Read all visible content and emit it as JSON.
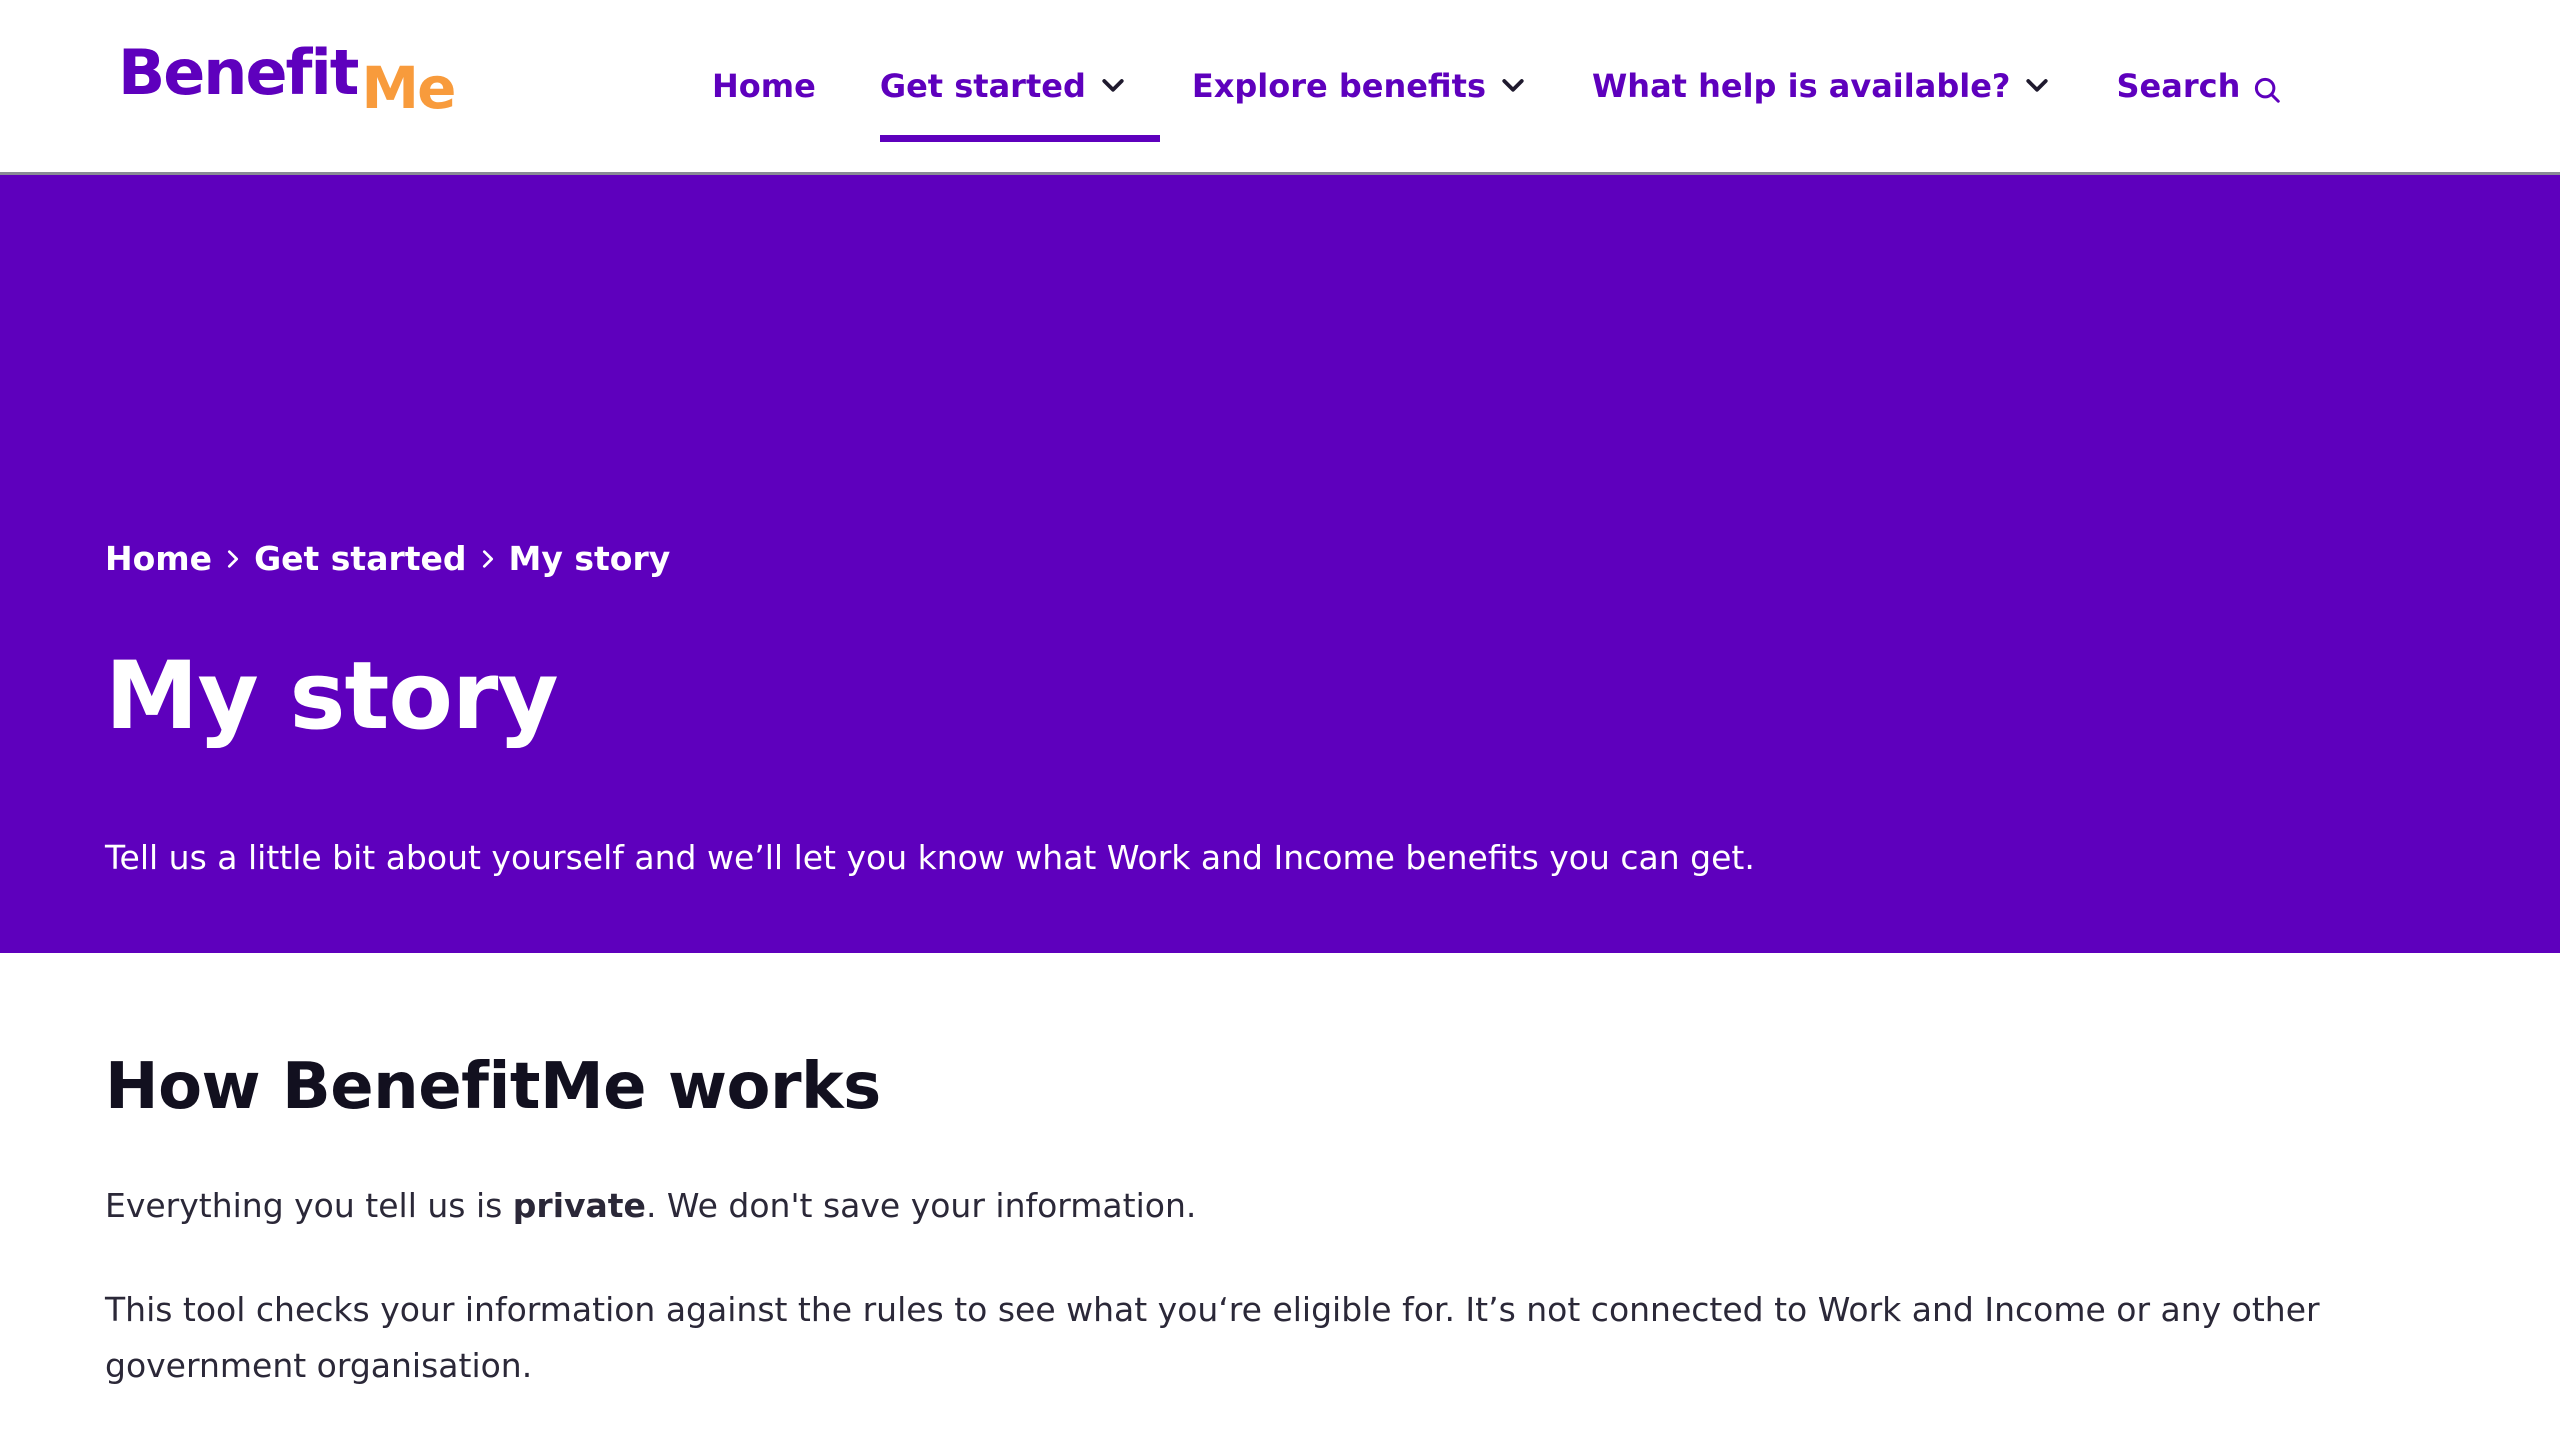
{
  "logo": {
    "part1": "Benefit",
    "part2": "Me"
  },
  "nav": [
    {
      "label": "Home",
      "dropdown": false,
      "active": false
    },
    {
      "label": "Get started",
      "dropdown": true,
      "active": true
    },
    {
      "label": "Explore benefits",
      "dropdown": true,
      "active": false
    },
    {
      "label": "What help is available?",
      "dropdown": true,
      "active": false
    },
    {
      "label": "Search",
      "dropdown": false,
      "active": false
    }
  ],
  "breadcrumb": [
    "Home",
    "Get started",
    "My story"
  ],
  "hero": {
    "title": "My story",
    "intro": "Tell us a little bit about yourself and we’ll let you know what Work and Income benefits you can get."
  },
  "section": {
    "heading": "How BenefitMe works",
    "para1_before": "Everything you tell us is ",
    "para1_bold": "private",
    "para1_after": ". We don't save your information.",
    "para2": "This tool checks your information against the rules to see what you‘re eligible for. It’s not connected to Work and Income or any other government organisation."
  },
  "colors": {
    "brand": "#5e00bd",
    "accent": "#f89b3c",
    "text": "#2b2838"
  }
}
